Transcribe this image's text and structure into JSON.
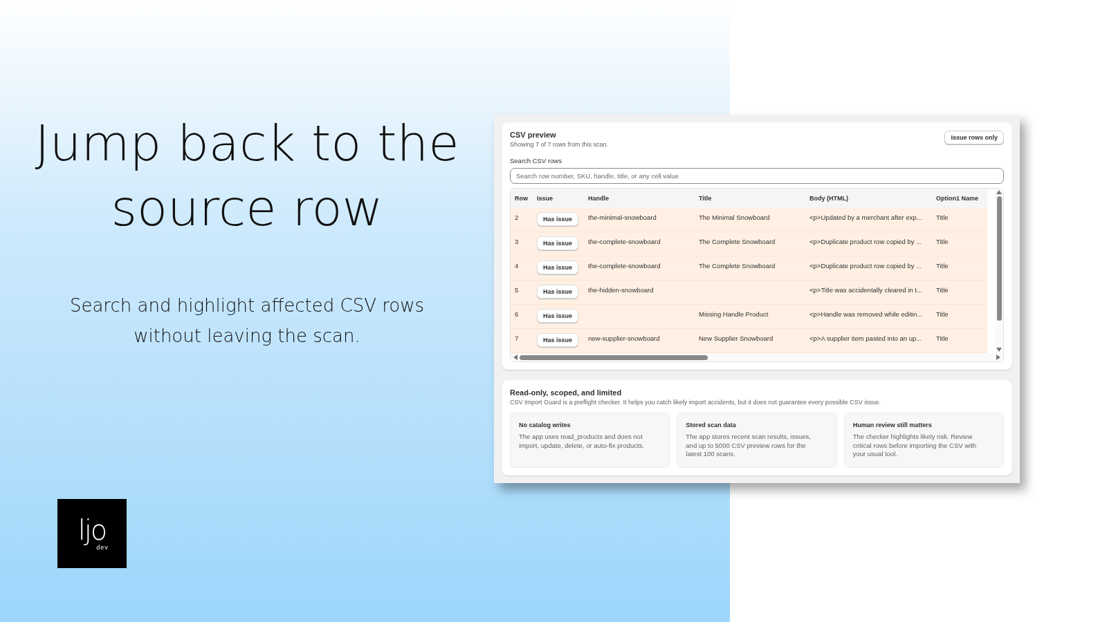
{
  "headline": "Jump back to the source row",
  "subtitle": "Search and highlight affected CSV rows without leaving the scan.",
  "logo": {
    "mark": "ljo",
    "caption": "dev"
  },
  "preview": {
    "title": "CSV preview",
    "subtitle": "Showing 7 of 7 rows from this scan.",
    "filter_button": "Issue rows only",
    "search": {
      "label": "Search CSV rows",
      "placeholder": "Search row number, SKU, handle, title, or any cell value"
    },
    "table": {
      "columns": [
        "Row",
        "Issue",
        "Handle",
        "Title",
        "Body (HTML)",
        "Option1 Name"
      ],
      "rows": [
        {
          "row": "2",
          "issue": "Has issue",
          "handle": "the-minimal-snowboard",
          "title": "The Minimal Snowboard",
          "body": "<p>Updated by a merchant after exp...",
          "option1": "Title",
          "highlighted": true
        },
        {
          "row": "3",
          "issue": "Has issue",
          "handle": "the-complete-snowboard",
          "title": "The Complete Snowboard",
          "body": "<p>Duplicate product row copied by ...",
          "option1": "Title",
          "highlighted": true
        },
        {
          "row": "4",
          "issue": "Has issue",
          "handle": "the-complete-snowboard",
          "title": "The Complete Snowboard",
          "body": "<p>Duplicate product row copied by ...",
          "option1": "Title",
          "highlighted": true
        },
        {
          "row": "5",
          "issue": "Has issue",
          "handle": "the-hidden-snowboard",
          "body": "<p>Title was accidentally cleared in t...",
          "option1": "Title",
          "highlighted": true
        },
        {
          "row": "6",
          "issue": "Has issue",
          "title": "Missing Handle Product",
          "body": "<p>Handle was removed while editin...",
          "option1": "Title",
          "highlighted": true
        },
        {
          "row": "7",
          "issue": "Has issue",
          "handle": "new-supplier-snowboard",
          "title": "New Supplier Snowboard",
          "body": "<p>A supplier item pasted into an up...",
          "option1": "Title",
          "highlighted": true
        }
      ]
    }
  },
  "notice": {
    "title": "Read-only, scoped, and limited",
    "text": "CSV Import Guard is a preflight checker. It helps you catch likely import accidents, but it does not guarantee every possible CSV issue.",
    "cards": [
      {
        "title": "No catalog writes",
        "text": "The app uses read_products and does not import, update, delete, or auto-fix products."
      },
      {
        "title": "Stored scan data",
        "text": "The app stores recent scan results, issues, and up to 5000 CSV preview rows for the latest 100 scans."
      },
      {
        "title": "Human review still matters",
        "text": "The checker highlights likely risk. Review critical rows before importing the CSV with your usual tool."
      }
    ]
  }
}
